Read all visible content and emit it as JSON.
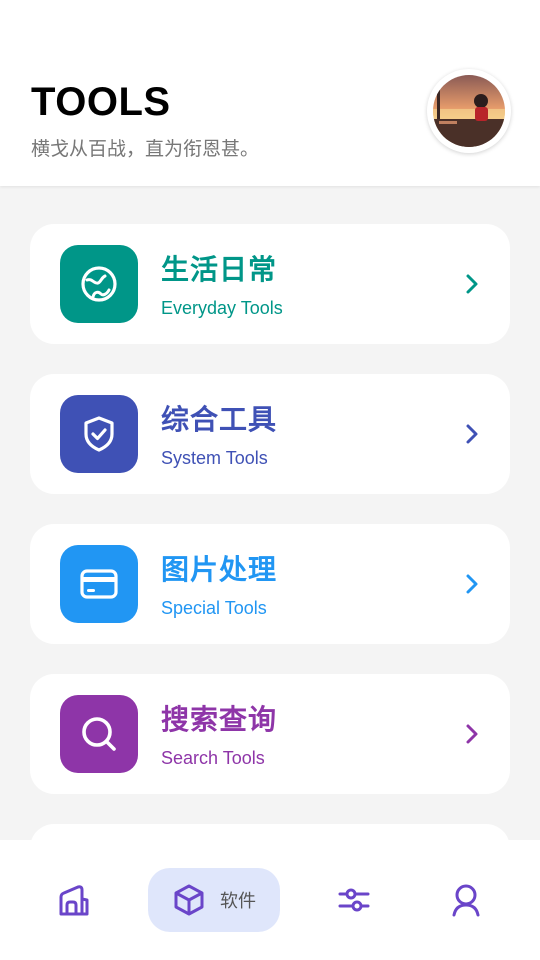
{
  "header": {
    "title": "TOOLS",
    "subtitle": "横戈从百战，直为衔恩甚。"
  },
  "categories": [
    {
      "title": "生活日常",
      "subtitle": "Everyday Tools",
      "color": "#009688",
      "icon": "globe-icon"
    },
    {
      "title": "综合工具",
      "subtitle": "System Tools",
      "color": "#3f51b5",
      "icon": "shield-check-icon"
    },
    {
      "title": "图片处理",
      "subtitle": "Special Tools",
      "color": "#2196f3",
      "icon": "card-icon"
    },
    {
      "title": "搜索查询",
      "subtitle": "Search Tools",
      "color": "#8e35a8",
      "icon": "search-icon"
    }
  ],
  "nav": {
    "items": [
      {
        "icon": "home-icon"
      },
      {
        "icon": "cube-icon",
        "label": "软件",
        "active": true
      },
      {
        "icon": "sliders-icon"
      },
      {
        "icon": "user-icon"
      }
    ],
    "accent": "#6a45c9",
    "active_bg": "#dfe6fb"
  }
}
